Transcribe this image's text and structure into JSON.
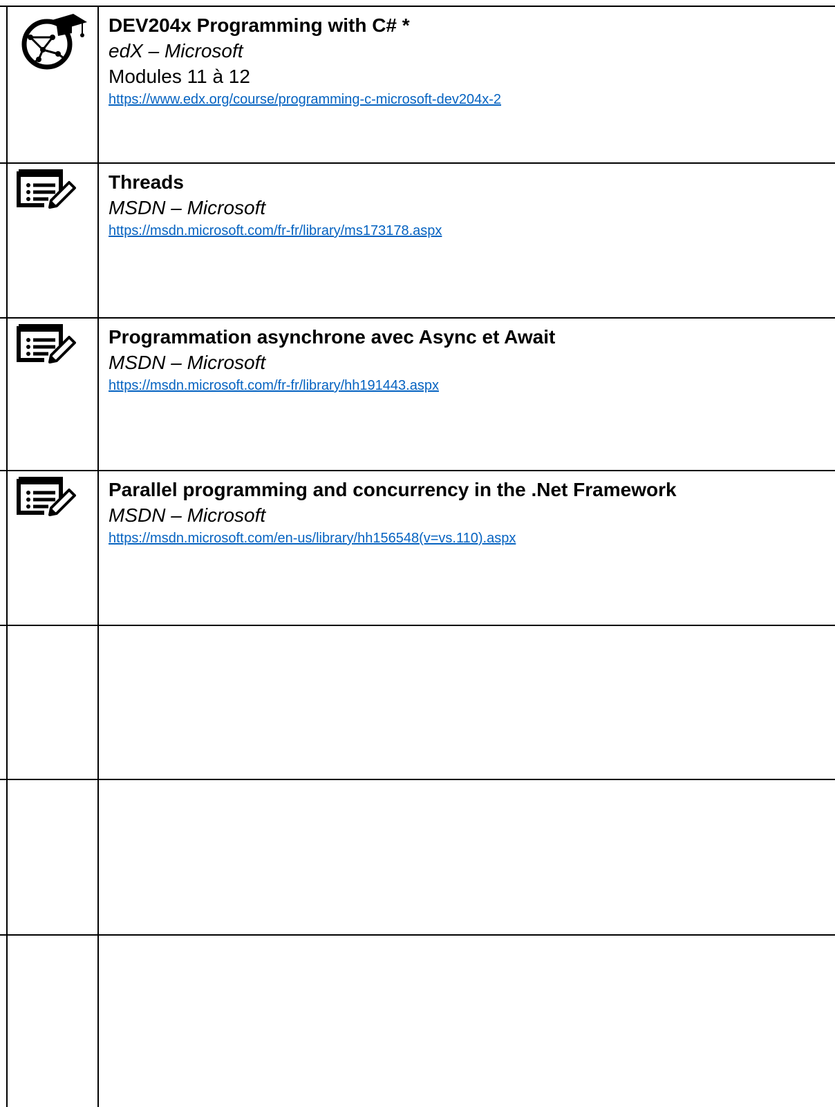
{
  "colors": {
    "link": "#0563c1",
    "border": "#000000"
  },
  "rows": [
    {
      "icon": "graduation-cap-globe-icon",
      "title": "DEV204x Programming with C# *",
      "source": "edX – Microsoft",
      "modules": "Modules 11 à 12",
      "link": "https://www.edx.org/course/programming-c-microsoft-dev204x-2"
    },
    {
      "icon": "list-edit-icon",
      "title": "Threads",
      "source": "MSDN – Microsoft",
      "link": "https://msdn.microsoft.com/fr-fr/library/ms173178.aspx"
    },
    {
      "icon": "list-edit-icon",
      "title": "Programmation asynchrone avec Async et Await",
      "source": "MSDN – Microsoft",
      "link": "https://msdn.microsoft.com/fr-fr/library/hh191443.aspx"
    },
    {
      "icon": "list-edit-icon",
      "title": "Parallel programming and concurrency in the .Net Framework",
      "source": "MSDN – Microsoft",
      "link": "https://msdn.microsoft.com/en-us/library/hh156548(v=vs.110).aspx"
    }
  ]
}
